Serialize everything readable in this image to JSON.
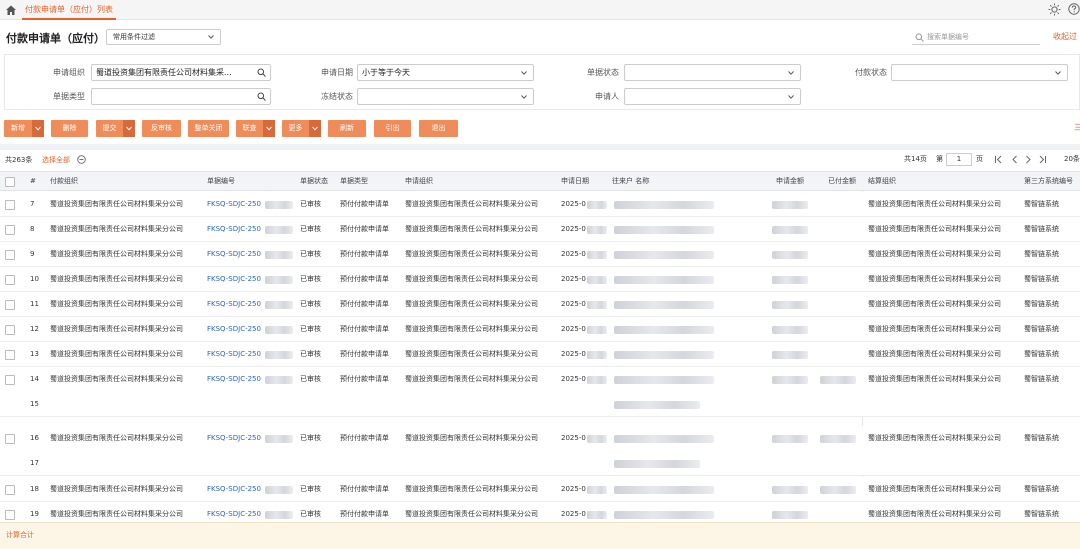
{
  "tab": {
    "title": "付款申请单（应付）列表"
  },
  "header": {
    "title": "付款申请单（应付）",
    "filter_select": "常用条件过滤",
    "search_placeholder": "搜索单据编号",
    "collapse_link": "收起过"
  },
  "filters": {
    "org_label": "申请组织",
    "org_value": "蜀道投资集团有限责任公司材料集采...",
    "date_label": "申请日期",
    "date_value": "小于等于今天",
    "status_label": "单据状态",
    "status_value": "",
    "paystatus_label": "付款状态",
    "paystatus_value": "",
    "type_label": "单据类型",
    "type_value": "",
    "freeze_label": "冻结状态",
    "freeze_value": "",
    "applicant_label": "申请人",
    "applicant_value": ""
  },
  "toolbar": {
    "new": "新增",
    "delete": "删除",
    "submit": "提交",
    "unaudit": "反审核",
    "close": "整单关闭",
    "link": "联查",
    "more": "更多",
    "refresh": "刷新",
    "export": "引出",
    "exit": "退出",
    "more_link": "三"
  },
  "list": {
    "total": "共263条",
    "select_all": "选择全部",
    "pages": "共14页",
    "page_prefix": "第",
    "page_value": "1",
    "page_suffix": "页",
    "page_size": "20条"
  },
  "columns": {
    "index": "#",
    "pay_org": "付款组织",
    "bill_no": "单据编号",
    "bill_status": "单据状态",
    "bill_type": "单据类型",
    "apply_org": "申请组织",
    "apply_date": "申请日期",
    "partner": "往来户 名称",
    "apply_amount": "申请金额",
    "paid_amount": "已付金额",
    "settle_org": "结算组织",
    "third_party": "第三方系统编号"
  },
  "rows": [
    {
      "index": "7",
      "pay_org": "蜀道投资集团有限责任公司材料集采分公司",
      "bill_no": "FKSQ-SDJC-250",
      "status": "已审核",
      "type": "预付付款申请单",
      "apply_org": "蜀道投资集团有限责任公司材料集采分公司",
      "date": "2025-0",
      "settle_org": "蜀道投资集团有限责任公司材料集采分公司",
      "third": "蜀智链系统"
    },
    {
      "index": "8",
      "pay_org": "蜀道投资集团有限责任公司材料集采分公司",
      "bill_no": "FKSQ-SDJC-250",
      "status": "已审核",
      "type": "预付付款申请单",
      "apply_org": "蜀道投资集团有限责任公司材料集采分公司",
      "date": "2025-0",
      "settle_org": "蜀道投资集团有限责任公司材料集采分公司",
      "third": "蜀智链系统"
    },
    {
      "index": "9",
      "pay_org": "蜀道投资集团有限责任公司材料集采分公司",
      "bill_no": "FKSQ-SDJC-250",
      "status": "已审核",
      "type": "预付付款申请单",
      "apply_org": "蜀道投资集团有限责任公司材料集采分公司",
      "date": "2025-0",
      "settle_org": "蜀道投资集团有限责任公司材料集采分公司",
      "third": "蜀智链系统"
    },
    {
      "index": "10",
      "pay_org": "蜀道投资集团有限责任公司材料集采分公司",
      "bill_no": "FKSQ-SDJC-250",
      "status": "已审核",
      "type": "预付付款申请单",
      "apply_org": "蜀道投资集团有限责任公司材料集采分公司",
      "date": "2025-0",
      "settle_org": "蜀道投资集团有限责任公司材料集采分公司",
      "third": "蜀智链系统"
    },
    {
      "index": "11",
      "pay_org": "蜀道投资集团有限责任公司材料集采分公司",
      "bill_no": "FKSQ-SDJC-250",
      "status": "已审核",
      "type": "预付付款申请单",
      "apply_org": "蜀道投资集团有限责任公司材料集采分公司",
      "date": "2025-0",
      "settle_org": "蜀道投资集团有限责任公司材料集采分公司",
      "third": "蜀智链系统"
    },
    {
      "index": "12",
      "pay_org": "蜀道投资集团有限责任公司材料集采分公司",
      "bill_no": "FKSQ-SDJC-250",
      "status": "已审核",
      "type": "预付付款申请单",
      "apply_org": "蜀道投资集团有限责任公司材料集采分公司",
      "date": "2025-0",
      "settle_org": "蜀道投资集团有限责任公司材料集采分公司",
      "third": "蜀智链系统"
    },
    {
      "index": "13",
      "pay_org": "蜀道投资集团有限责任公司材料集采分公司",
      "bill_no": "FKSQ-SDJC-250",
      "status": "已审核",
      "type": "预付付款申请单",
      "apply_org": "蜀道投资集团有限责任公司材料集采分公司",
      "date": "2025-0",
      "settle_org": "蜀道投资集团有限责任公司材料集采分公司",
      "third": "蜀智链系统"
    },
    {
      "index": "14",
      "pay_org": "蜀道投资集团有限责任公司材料集采分公司",
      "bill_no": "FKSQ-SDJC-250",
      "status": "已审核",
      "type": "预付付款申请单",
      "apply_org": "蜀道投资集团有限责任公司材料集采分公司",
      "date": "2025-0",
      "settle_org": "蜀道投资集团有限责任公司材料集采分公司",
      "third": "蜀智链系统"
    },
    {
      "index": "15"
    },
    {
      "index": "16",
      "pay_org": "蜀道投资集团有限责任公司材料集采分公司",
      "bill_no": "FKSQ-SDJC-250",
      "status": "已审核",
      "type": "预付付款申请单",
      "apply_org": "蜀道投资集团有限责任公司材料集采分公司",
      "date": "2025-0",
      "settle_org": "蜀道投资集团有限责任公司材料集采分公司",
      "third": "蜀智链系统"
    },
    {
      "index": "17"
    },
    {
      "index": "18",
      "pay_org": "蜀道投资集团有限责任公司材料集采分公司",
      "bill_no": "FKSQ-SDJC-250",
      "status": "已审核",
      "type": "预付付款申请单",
      "apply_org": "蜀道投资集团有限责任公司材料集采分公司",
      "date": "2025-0",
      "settle_org": "蜀道投资集团有限责任公司材料集采分公司",
      "third": "蜀智链系统"
    },
    {
      "index": "19",
      "pay_org": "蜀道投资集团有限责任公司材料集采分公司",
      "bill_no": "FKSQ-SDJC-250",
      "status": "已审核",
      "type": "预付付款申请单",
      "apply_org": "蜀道投资集团有限责任公司材料集采分公司",
      "date": "2025-0",
      "settle_org": "蜀道投资集团有限责任公司材料集采分公司",
      "third": "蜀智链系统"
    }
  ],
  "footer": {
    "total_label": "计算合计"
  },
  "colors": {
    "accent": "#e8612a",
    "button": "#f08c5a",
    "link": "#2a63c8"
  },
  "icons": [
    "home-icon",
    "sun-icon",
    "help-icon",
    "search-icon",
    "chevron-down-icon",
    "minus-circle-icon",
    "first-page-icon",
    "prev-page-icon",
    "next-page-icon",
    "last-page-icon"
  ]
}
